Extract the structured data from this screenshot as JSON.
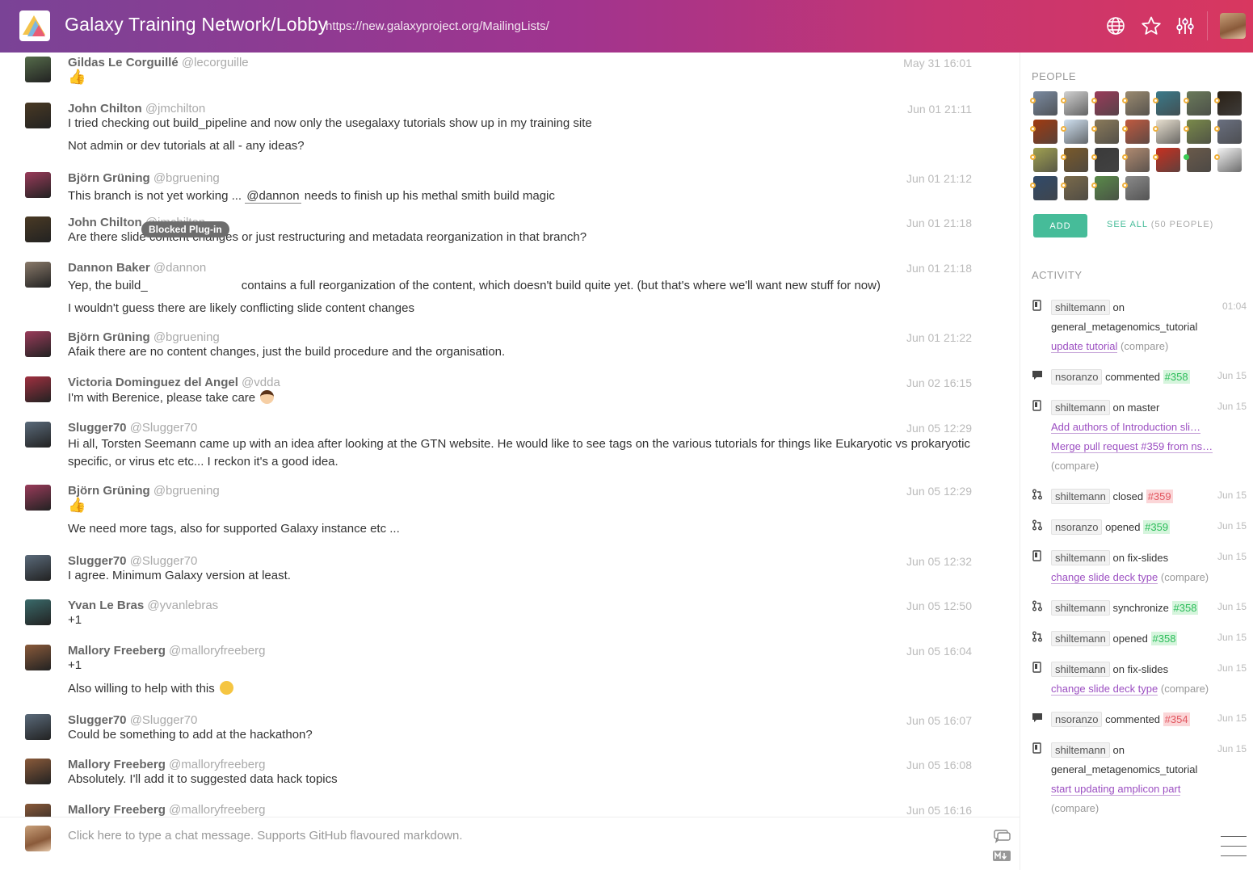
{
  "header": {
    "room_title": "Galaxy Training Network/Lobby",
    "topic_url": "https://new.galaxyproject.org/MailingLists/",
    "icons": [
      "globe-icon",
      "star-icon",
      "settings-sliders-icon"
    ]
  },
  "messages": [
    {
      "name": "Gildas Le Corguillé",
      "handle": "@lecorguille",
      "time": "May 31 16:01",
      "lines": [
        "👍"
      ],
      "avatar_color": "#556b4a"
    },
    {
      "name": "John Chilton",
      "handle": "@jmchilton",
      "time": "Jun 01 21:11",
      "lines": [
        "I tried checking out build_pipeline and now only the usegalaxy tutorials show up in my training site",
        "Not admin or dev tutorials at all - any ideas?"
      ],
      "avatar_color": "#4a3a24"
    },
    {
      "name": "Björn Grüning",
      "handle": "@bgruening",
      "time": "Jun 01 21:12",
      "lines_pre": "This branch is not yet working ... ",
      "mention": "@dannon",
      "lines_post": " needs to finish up his methal smith build magic",
      "avatar_color": "#9a3b5a"
    },
    {
      "name": "John Chilton",
      "handle": "@jmchilton",
      "time": "Jun 01 21:18",
      "lines": [
        "Are there slide content changes or just restructuring and metadata reorganization in that branch?"
      ],
      "avatar_color": "#4a3a24"
    },
    {
      "name": "Dannon Baker",
      "handle": "@dannon",
      "time": "Jun 01 21:18",
      "line1_pre": "Yep, the build_",
      "line1_post": "contains a full reorganization of the content, which doesn't build quite yet. (but that's where we'll want new stuff for now)",
      "lines": [
        "I wouldn't guess there are likely conflicting slide content changes"
      ],
      "blocked_label": "Blocked Plug-in",
      "avatar_color": "#8a7a6a"
    },
    {
      "name": "Björn Grüning",
      "handle": "@bgruening",
      "time": "Jun 01 21:22",
      "lines": [
        "Afaik there are no content changes, just the build procedure and the organisation."
      ],
      "avatar_color": "#9a3b5a"
    },
    {
      "name": "Victoria Dominguez del Angel",
      "handle": "@vdda",
      "time": "Jun 02 16:15",
      "lines": [
        "I'm with Berenice, please take care"
      ],
      "avatar_color": "#a03040"
    },
    {
      "name": "Slugger70",
      "handle": "@Slugger70",
      "time": "Jun 05 12:29",
      "lines": [
        "Hi all, Torsten Seemann came up with an idea after looking at the GTN website. He would like to see tags on the various tutorials for things like Eukaryotic vs prokaryotic specific, or virus etc etc... I reckon it's a good idea."
      ],
      "avatar_color": "#5a6a7a"
    },
    {
      "name": "Björn Grüning",
      "handle": "@bgruening",
      "time": "Jun 05 12:29",
      "lines": [
        "👍",
        "We need more tags, also for supported Galaxy instance etc ..."
      ],
      "avatar_color": "#9a3b5a"
    },
    {
      "name": "Slugger70",
      "handle": "@Slugger70",
      "time": "Jun 05 12:32",
      "lines": [
        "I agree. Minimum Galaxy version at least."
      ],
      "avatar_color": "#5a6a7a"
    },
    {
      "name": "Yvan Le Bras",
      "handle": "@yvanlebras",
      "time": "Jun 05 12:50",
      "lines": [
        "+1"
      ],
      "avatar_color": "#3a6a6a"
    },
    {
      "name": "Mallory Freeberg",
      "handle": "@malloryfreeberg",
      "time": "Jun 05 16:04",
      "lines": [
        "+1",
        "Also willing to help with this"
      ],
      "avatar_color": "#8a5a3a"
    },
    {
      "name": "Slugger70",
      "handle": "@Slugger70",
      "time": "Jun 05 16:07",
      "lines": [
        "Could be something to add at the hackathon?"
      ],
      "avatar_color": "#5a6a7a"
    },
    {
      "name": "Mallory Freeberg",
      "handle": "@malloryfreeberg",
      "time": "Jun 05 16:08",
      "lines": [
        "Absolutely. I'll add it to suggested data hack topics"
      ],
      "avatar_color": "#8a5a3a"
    },
    {
      "name": "Mallory Freeberg",
      "handle": "@malloryfreeberg",
      "time": "Jun 05 16:16",
      "lines": [],
      "avatar_color": "#8a5a3a"
    }
  ],
  "composer": {
    "placeholder": "Click here to type a chat message. Supports GitHub flavoured markdown."
  },
  "panel": {
    "people_heading": "PEOPLE",
    "people_colors": [
      "#7a8aa0",
      "#d0d0d0",
      "#9a3b5a",
      "#9a8a70",
      "#3a7a8a",
      "#6a7a5a",
      "#2a2015",
      "#a03a10",
      "#cfe0f0",
      "#8a7a5a",
      "#c05a40",
      "#e8e0d0",
      "#7a8a4a",
      "#6a7080",
      "#a0a050",
      "#7a5a2a",
      "#3a3a3a",
      "#b08a70",
      "#c83020",
      "#6a5a4a",
      "#f4f4f4",
      "#304a6a",
      "#7a6a4a",
      "#5a8a4a",
      "#8a8a8a"
    ],
    "online_index": 19,
    "add_label": "ADD",
    "see_all_label": "SEE ALL",
    "see_all_count": "(50 PEOPLE)",
    "activity_heading": "ACTIVITY",
    "activity": [
      {
        "icon": "push-icon",
        "user": "shiltemann",
        "verb": "on",
        "target": "general_metagenomics_tutorial",
        "links": [
          "update tutorial"
        ],
        "compare": "(compare)",
        "time": "01:04"
      },
      {
        "icon": "comment-icon",
        "user": "nsoranzo",
        "verb": "commented",
        "issue": "#358",
        "issue_color": "green",
        "time": "Jun 15"
      },
      {
        "icon": "push-icon",
        "user": "shiltemann",
        "verb": "on master",
        "links": [
          "Add authors of Introduction sli…",
          "Merge pull request #359 from ns…"
        ],
        "compare": "(compare)",
        "time": "Jun 15"
      },
      {
        "icon": "pr-icon",
        "user": "shiltemann",
        "verb": "closed",
        "issue": "#359",
        "issue_color": "red",
        "time": "Jun 15"
      },
      {
        "icon": "pr-icon",
        "user": "nsoranzo",
        "verb": "opened",
        "issue": "#359",
        "issue_color": "green",
        "time": "Jun 15"
      },
      {
        "icon": "push-icon",
        "user": "shiltemann",
        "verb": "on fix-slides",
        "links": [
          "change slide deck type"
        ],
        "compare": "(compare)",
        "time": "Jun 15"
      },
      {
        "icon": "pr-icon",
        "user": "shiltemann",
        "verb": "synchronize",
        "issue": "#358",
        "issue_color": "green",
        "time": "Jun 15"
      },
      {
        "icon": "pr-icon",
        "user": "shiltemann",
        "verb": "opened",
        "issue": "#358",
        "issue_color": "green",
        "time": "Jun 15"
      },
      {
        "icon": "push-icon",
        "user": "shiltemann",
        "verb": "on fix-slides",
        "links": [
          "change slide deck type"
        ],
        "compare": "(compare)",
        "time": "Jun 15"
      },
      {
        "icon": "comment-icon",
        "user": "nsoranzo",
        "verb": "commented",
        "issue": "#354",
        "issue_color": "red",
        "time": "Jun 15"
      },
      {
        "icon": "push-icon",
        "user": "shiltemann",
        "verb": "on",
        "target": "general_metagenomics_tutorial",
        "links": [
          "start updating amplicon part"
        ],
        "compare": "(compare)",
        "time": "Jun 15"
      }
    ]
  }
}
